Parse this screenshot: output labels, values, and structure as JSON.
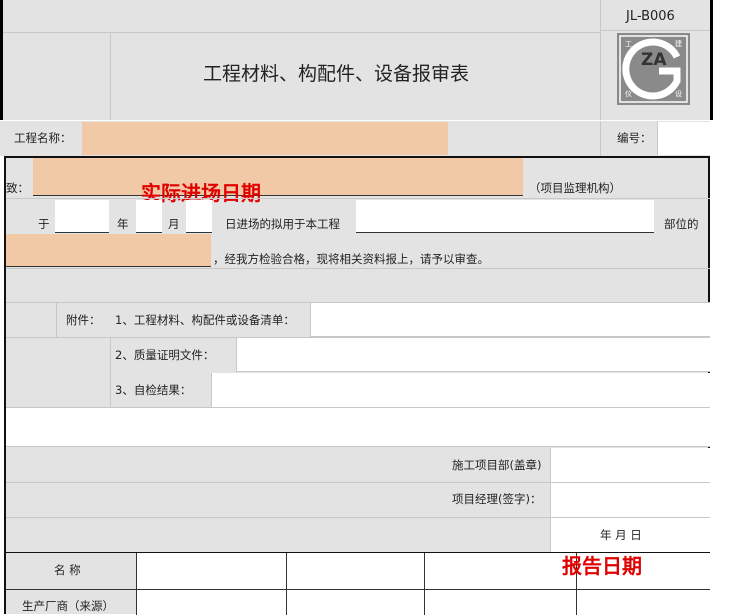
{
  "form": {
    "code": "JL-B006",
    "title": "工程材料、构配件、设备报审表",
    "logo_text": "ZA",
    "logo_chars": [
      "工",
      "建",
      "仪",
      "设"
    ]
  },
  "row_project": {
    "project_label": "工程名称：",
    "number_label": "编号："
  },
  "row_to": {
    "to_label": "致：",
    "supervisor_label": "（项目监理机构）",
    "annotation_entry_date": "实际进场日期"
  },
  "row_date": {
    "yu": "于",
    "year": "年",
    "month": "月",
    "entry_text": "日进场的拟用于本工程",
    "part_text": "部位的"
  },
  "row_inspect": {
    "text": "，经我方检验合格，现将相关资料报上，请予以审查。"
  },
  "attachments": {
    "label": "附件：",
    "item1": "1、工程材料、构配件或设备清单：",
    "item2": "2、质量证明文件：",
    "item3": "3、自检结果："
  },
  "sign": {
    "dept_label": "施工项目部(盖章)",
    "manager_label": "项目经理(签字)：",
    "date_text": "年   月   日",
    "annotation_report_date": "报告日期"
  },
  "table": {
    "name_label": "名 称",
    "manufacturer_label": "生产厂商（来源）"
  }
}
